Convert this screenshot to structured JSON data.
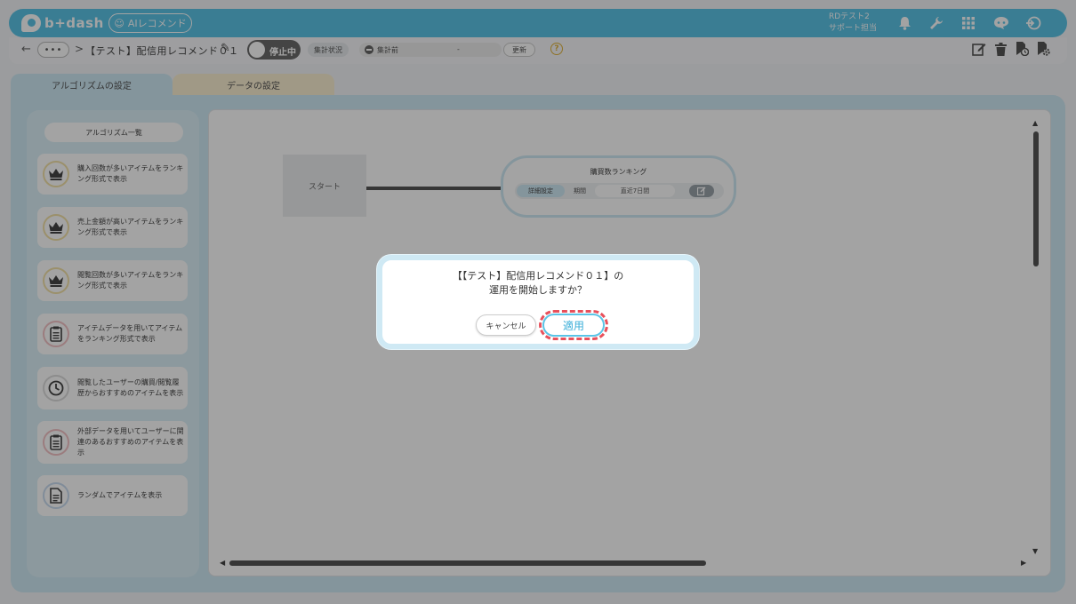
{
  "header": {
    "brand": "b+dash",
    "ai_badge": "AIレコメンド",
    "user_line1": "RDテスト2",
    "user_line2": "サポート担当"
  },
  "toolbar": {
    "more": "•••",
    "crumb_sep": ">",
    "title": "【テスト】配信用レコメンド０１",
    "toggle_label": "停止中",
    "status_label": "集計状況",
    "status_value": "集計前",
    "status_dash": "-",
    "update_label": "更新",
    "help": "?"
  },
  "tabs": {
    "algorithm": "アルゴリズムの設定",
    "data": "データの設定"
  },
  "sidebar": {
    "title": "アルゴリズム一覧",
    "items": [
      {
        "label": "購入回数が多いアイテムをランキング形式で表示",
        "icon": "crown-icon"
      },
      {
        "label": "売上金額が高いアイテムをランキング形式で表示",
        "icon": "crown-icon"
      },
      {
        "label": "閲覧回数が多いアイテムをランキング形式で表示",
        "icon": "crown-icon"
      },
      {
        "label": "アイテムデータを用いてアイテムをランキング形式で表示",
        "icon": "clipboard-icon"
      },
      {
        "label": "閲覧したユーザーの購買/閲覧履歴からおすすめのアイテムを表示",
        "icon": "clock-icon"
      },
      {
        "label": "外部データを用いてユーザーに関連のあるおすすめのアイテムを表示",
        "icon": "clipboard-icon"
      },
      {
        "label": "ランダムでアイテムを表示",
        "icon": "document-icon"
      }
    ]
  },
  "canvas": {
    "start": "スタート",
    "rank_title": "購買数ランキング",
    "detail": "詳細設定",
    "period_label": "期間",
    "period_value": "直近7日間"
  },
  "modal": {
    "line1": "【【テスト】配信用レコメンド０１】の",
    "line2": "運用を開始しますか？",
    "cancel": "キャンセル",
    "apply": "適用"
  },
  "colors": {
    "accent": "#5bc4e6",
    "panel": "#cfe9f4",
    "data_tab": "#fbefd2",
    "highlight": "#e8505b"
  }
}
